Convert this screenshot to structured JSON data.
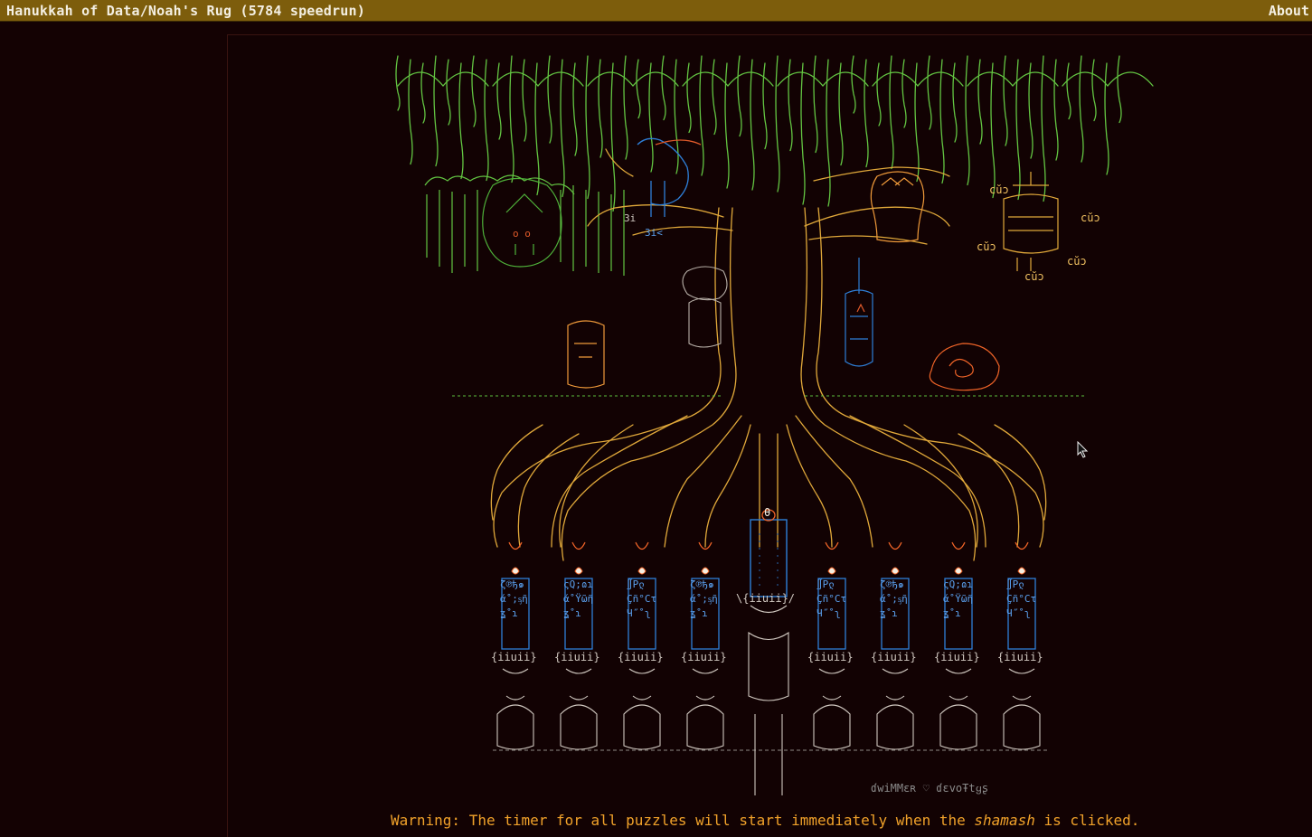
{
  "header": {
    "title": "Hanukkah of Data/Noah's Rug (5784 speedrun)",
    "about_label": "About"
  },
  "art": {
    "signature": "ɗwiMMɛʀ ♡ ɗɛvoŦtყʂ",
    "labels": {
      "dragon_a": "3i",
      "dragon_b": "3i<",
      "lantern_cuc_1": "cŭɔ",
      "lantern_cuc_2": "cŭɔ",
      "lantern_cuc_3": "cŭɔ",
      "lantern_cuc_4": "cŭɔ",
      "lantern_cuc_5": "cŭɔ",
      "base_label": "{iiuii}",
      "shamash_base": "\\{iiuii}/",
      "shamash_flame": "θ"
    },
    "candle_glyphs": [
      {
        "top": "ζ℗ђ๑",
        "mid": "ά˚;ᶊῆ",
        "low": "ʓ˚ɿ"
      },
      {
        "top": "ςQ;ɷɿ",
        "mid": "ά˚Ÿῶῆ",
        "low": "ʓ˚ɿ"
      },
      {
        "top": "∬Рლ",
        "mid": "Çñ°Cτ",
        "low": "Ч˝˚ʅ"
      },
      {
        "top": "ζ℗ђ๑",
        "mid": "ά˚;ᶊῆ",
        "low": "ʓ˚ɿ"
      },
      {
        "top": "∬Рლ",
        "mid": "Çñ°Cτ",
        "low": "Ч˝˚ʅ"
      },
      {
        "top": "ζ℗ђ๑",
        "mid": "ά˚;ᶊῆ",
        "low": "ʓ˚ɿ"
      },
      {
        "top": "ςQ;ɷɿ",
        "mid": "ά˚Ÿῶῆ",
        "low": "ʓ˚ɿ"
      },
      {
        "top": "∬Рლ",
        "mid": "Çñ°Cτ",
        "low": "Ч˝˚ʅ"
      }
    ]
  },
  "warning": {
    "prefix": "Warning: The timer for all puzzles will start immediately when the ",
    "emphasis": "shamash",
    "suffix": " is clicked."
  },
  "colors": {
    "background": "#140203",
    "header_bg": "#7d5d0c",
    "header_text": "#f4efe2",
    "foliage": "#63c542",
    "trunk": "#e0a83a",
    "candle": "#2e7fd8",
    "flame": "#f06428",
    "warning": "#f1a22a",
    "menorah": "#cdc7c0"
  }
}
